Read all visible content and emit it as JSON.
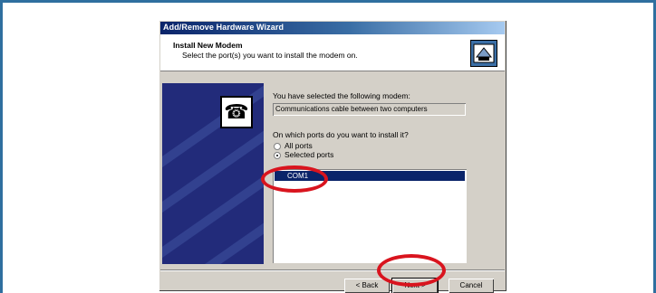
{
  "window": {
    "title": "Add/Remove Hardware Wizard"
  },
  "header": {
    "title": "Install New Modem",
    "subtitle": "Select the port(s) you want to install the modem on."
  },
  "content": {
    "selected_label": "You have selected the following modem:",
    "modem_name": "Communications cable between two computers",
    "question": "On which ports do you want to install it?",
    "radio_all": "All ports",
    "radio_selected": "Selected ports",
    "selected_radio": "Selected ports",
    "ports": [
      "COM1"
    ]
  },
  "buttons": {
    "back": "< Back",
    "next": "Next >",
    "cancel": "Cancel"
  },
  "colors": {
    "frame_border": "#2f6f9f",
    "annotation_ring": "#d9141e",
    "titlebar_start": "#0a246a",
    "dialog_face": "#d4d0c8",
    "side_panel": "#222b7a"
  }
}
